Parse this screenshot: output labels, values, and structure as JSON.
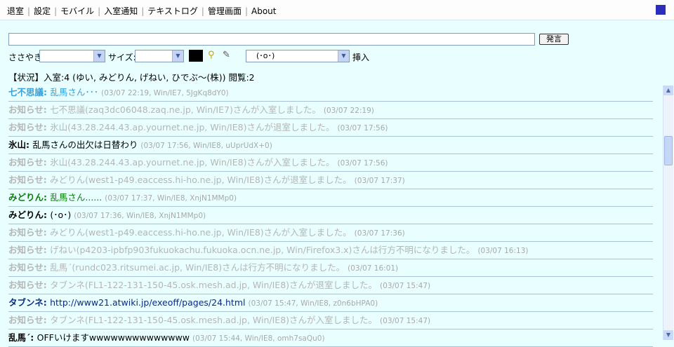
{
  "menu": [
    {
      "label": "退室"
    },
    {
      "label": "設定"
    },
    {
      "label": "モバイル"
    },
    {
      "label": "入室通知"
    },
    {
      "label": "テキストログ"
    },
    {
      "label": "管理画面"
    },
    {
      "label": "About"
    }
  ],
  "say_button": "発言",
  "say_input_value": "",
  "whisper_label": "ささやき:",
  "whisper_value": "",
  "size_label": "サイズ:",
  "size_value": "",
  "face_value": "(･o･)",
  "insert_label": "挿入",
  "status": "【状況】入室:4 (ゆい, みどりん, げねい, ひでぶ～(株)) 閲覧:2",
  "colors": {
    "background": "#e9ffff",
    "name_blue": "#3ba0d8",
    "name_green": "#0a7f0a",
    "name_navy": "#0a2a8a",
    "system_gray": "#b5b5b5",
    "corner_box": "#2d2dbb"
  },
  "messages": [
    {
      "name": "七不思議",
      "text": "乱馬さん･･･",
      "meta": "(03/07 22:19, Win/IE7, 5JgKq8dY0)",
      "color": "#3ba0d8",
      "sys": false
    },
    {
      "name": "お知らせ",
      "text": "七不思議(zaq3dc06048.zaq.ne.jp, Win/IE7)さんが入室しました。",
      "meta": "(03/07 22:19)",
      "color": "#b5b5b5",
      "sys": true
    },
    {
      "name": "お知らせ",
      "text": "氷山(43.28.244.43.ap.yournet.ne.jp, Win/IE8)さんが退室しました。",
      "meta": "(03/07 17:56)",
      "color": "#b5b5b5",
      "sys": true
    },
    {
      "name": "氷山",
      "text": "乱馬さんの出欠は日替わり",
      "meta": "(03/07 17:56, Win/IE8, uUprUdX+0)",
      "color": "#000000",
      "sys": false
    },
    {
      "name": "お知らせ",
      "text": "氷山(43.28.244.43.ap.yournet.ne.jp, Win/IE8)さんが入室しました。",
      "meta": "(03/07 17:56)",
      "color": "#b5b5b5",
      "sys": true
    },
    {
      "name": "お知らせ",
      "text": "みどりん(west1-p49.eaccess.hi-ho.ne.jp, Win/IE8)さんが退室しました。",
      "meta": "(03/07 17:37)",
      "color": "#b5b5b5",
      "sys": true
    },
    {
      "name": "みどりん",
      "text": "乱馬さん......",
      "meta": "(03/07 17:37, Win/IE8, XnjN1MMp0)",
      "color": "#0a7f0a",
      "sys": false
    },
    {
      "name": "みどりん",
      "text": "(･o･)",
      "meta": "(03/07 17:36, Win/IE8, XnjN1MMp0)",
      "color": "#000000",
      "sys": false
    },
    {
      "name": "お知らせ",
      "text": "みどりん(west1-p49.eaccess.hi-ho.ne.jp, Win/IE8)さんが入室しました。",
      "meta": "(03/07 17:36)",
      "color": "#b5b5b5",
      "sys": true
    },
    {
      "name": "お知らせ",
      "text": "げねい(p4203-ipbfp903fukuokachu.fukuoka.ocn.ne.jp, Win/Firefox3.x)さんは行方不明になりました。",
      "meta": "(03/07 16:13)",
      "color": "#b5b5b5",
      "sys": true
    },
    {
      "name": "お知らせ",
      "text": "乱馬´(rundc023.ritsumei.ac.jp, Win/IE8)さんは行方不明になりました。",
      "meta": "(03/07 16:01)",
      "color": "#b5b5b5",
      "sys": true
    },
    {
      "name": "お知らせ",
      "text": "タブンネ(FL1-122-131-150-45.osk.mesh.ad.jp, Win/IE8)さんが退室しました。",
      "meta": "(03/07 15:47)",
      "color": "#b5b5b5",
      "sys": true
    },
    {
      "name": "タブンネ",
      "text": "http://www21.atwiki.jp/exeoff/pages/24.html",
      "meta": "(03/07 15:47, Win/IE8, z0n6bHPA0)",
      "color": "#0a2a8a",
      "sys": false
    },
    {
      "name": "お知らせ",
      "text": "タブンネ(FL1-122-131-150-45.osk.mesh.ad.jp, Win/IE8)さんが入室しました。",
      "meta": "(03/07 15:47)",
      "color": "#b5b5b5",
      "sys": true
    },
    {
      "name": "乱馬´",
      "text": "OFFいけますwwwwwwwwwwwwww",
      "meta": "(03/07 15:44, Win/IE8, omh7saQu0)",
      "color": "#000000",
      "sys": false
    }
  ]
}
